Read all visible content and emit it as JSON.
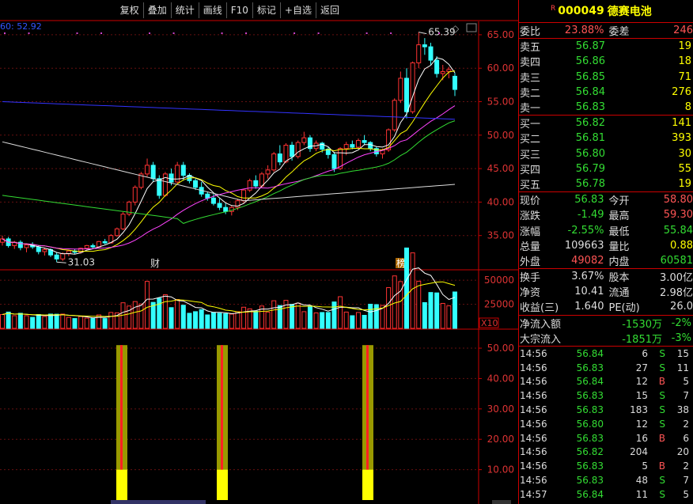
{
  "toolbar": [
    "复权",
    "叠加",
    "统计",
    "画线",
    "F10",
    "标记",
    "+自选",
    "返回"
  ],
  "stock": {
    "code": "000049",
    "name": "德赛电池",
    "code_color": "#ffff00",
    "name_color": "#ffff00"
  },
  "order_ratio": {
    "label1": "委比",
    "value1": "23.88%",
    "label2": "委差",
    "value2": "246"
  },
  "asks": [
    {
      "label": "卖五",
      "price": "56.87",
      "vol": "19"
    },
    {
      "label": "卖四",
      "price": "56.86",
      "vol": "18"
    },
    {
      "label": "卖三",
      "price": "56.85",
      "vol": "71"
    },
    {
      "label": "卖二",
      "price": "56.84",
      "vol": "276"
    },
    {
      "label": "卖一",
      "price": "56.83",
      "vol": "8"
    }
  ],
  "bids": [
    {
      "label": "买一",
      "price": "56.82",
      "vol": "141"
    },
    {
      "label": "买二",
      "price": "56.81",
      "vol": "393"
    },
    {
      "label": "买三",
      "price": "56.80",
      "vol": "30"
    },
    {
      "label": "买四",
      "price": "56.79",
      "vol": "55"
    },
    {
      "label": "买五",
      "price": "56.78",
      "vol": "19"
    }
  ],
  "quote": [
    {
      "l1": "现价",
      "v1": "56.83",
      "c1": "green",
      "l2": "今开",
      "v2": "58.80",
      "c2": "red"
    },
    {
      "l1": "涨跌",
      "v1": "-1.49",
      "c1": "green",
      "l2": "最高",
      "v2": "59.30",
      "c2": "red"
    },
    {
      "l1": "涨幅",
      "v1": "-2.55%",
      "c1": "green",
      "l2": "最低",
      "v2": "55.84",
      "c2": "green"
    },
    {
      "l1": "总量",
      "v1": "109663",
      "c1": "white",
      "l2": "量比",
      "v2": "0.88",
      "c2": "yellow"
    },
    {
      "l1": "外盘",
      "v1": "49082",
      "c1": "red",
      "l2": "内盘",
      "v2": "60581",
      "c2": "green"
    }
  ],
  "fundamentals": [
    {
      "l1": "换手",
      "v1": "3.67%",
      "l2": "股本",
      "v2": "3.00亿"
    },
    {
      "l1": "净资",
      "v1": "10.41",
      "l2": "流通",
      "v2": "2.98亿"
    },
    {
      "l1": "收益(三)",
      "v1": "1.640",
      "l2": "PE(动)",
      "v2": "26.0"
    }
  ],
  "flows": [
    {
      "label": "净流入额",
      "value": "-1530万",
      "pct": "-2%"
    },
    {
      "label": "大宗流入",
      "value": "-1851万",
      "pct": "-3%"
    }
  ],
  "ticks": [
    {
      "time": "14:56",
      "price": "56.84",
      "vol": "6",
      "bs": "S",
      "n": "15"
    },
    {
      "time": "14:56",
      "price": "56.83",
      "vol": "27",
      "bs": "S",
      "n": "11"
    },
    {
      "time": "14:56",
      "price": "56.84",
      "vol": "12",
      "bs": "B",
      "n": "5"
    },
    {
      "time": "14:56",
      "price": "56.83",
      "vol": "15",
      "bs": "S",
      "n": "7"
    },
    {
      "time": "14:56",
      "price": "56.83",
      "vol": "183",
      "bs": "S",
      "n": "38"
    },
    {
      "time": "14:56",
      "price": "56.80",
      "vol": "12",
      "bs": "S",
      "n": "2"
    },
    {
      "time": "14:56",
      "price": "56.83",
      "vol": "16",
      "bs": "B",
      "n": "6"
    },
    {
      "time": "14:56",
      "price": "56.82",
      "vol": "204",
      "bs": "",
      "n": "20"
    },
    {
      "time": "14:56",
      "price": "56.83",
      "vol": "5",
      "bs": "B",
      "n": "2"
    },
    {
      "time": "14:56",
      "price": "56.83",
      "vol": "48",
      "bs": "S",
      "n": "7"
    },
    {
      "time": "14:57",
      "price": "56.84",
      "vol": "11",
      "bs": "S",
      "n": "5"
    }
  ],
  "chart_data": [
    {
      "type": "candlestick",
      "ma_legend": "60: 52.92",
      "y_ticks": [
        "65.00",
        "60.00",
        "55.00",
        "50.00",
        "45.00",
        "40.00",
        "35.00"
      ],
      "ylim": [
        30,
        67
      ],
      "high_annotation": "65.39",
      "low_annotation": "31.03",
      "markers": [
        "财",
        "榜"
      ],
      "up_color": "#ff3333",
      "down_color": "#33ffff",
      "candles": [
        [
          34,
          35,
          33.5,
          34.5
        ],
        [
          34.5,
          34.8,
          33.2,
          33.5
        ],
        [
          33.5,
          34.2,
          33,
          34
        ],
        [
          34,
          34.3,
          32.8,
          33.2
        ],
        [
          33.2,
          33.8,
          32.5,
          33.6
        ],
        [
          33.6,
          34,
          33,
          33.3
        ],
        [
          33.3,
          33.5,
          32.2,
          32.6
        ],
        [
          32.6,
          33.2,
          32,
          32.9
        ],
        [
          32.9,
          33.1,
          31.8,
          32.1
        ],
        [
          32.1,
          32.5,
          31.03,
          31.5
        ],
        [
          31.5,
          32.5,
          31.2,
          32.3
        ],
        [
          32.3,
          32.8,
          31.9,
          32.7
        ],
        [
          32.7,
          33,
          32.2,
          32.5
        ],
        [
          32.5,
          33.2,
          32.3,
          33.1
        ],
        [
          33.1,
          33.6,
          32.9,
          33.5
        ],
        [
          33.5,
          33.8,
          33,
          33.3
        ],
        [
          33.3,
          34.2,
          33.1,
          34.1
        ],
        [
          34.1,
          34.5,
          33.7,
          33.9
        ],
        [
          33.9,
          35.2,
          33.8,
          35
        ],
        [
          35,
          36.2,
          34.8,
          36
        ],
        [
          36,
          38.5,
          35.8,
          38.2
        ],
        [
          38.2,
          40.2,
          37.9,
          40
        ],
        [
          40,
          42.5,
          39.5,
          42.2
        ],
        [
          42.2,
          44.5,
          41.9,
          44.2
        ],
        [
          44.2,
          46.5,
          43.8,
          45.5
        ],
        [
          45.5,
          46,
          43,
          43.5
        ],
        [
          43.5,
          44,
          40.5,
          41
        ],
        [
          41,
          44.5,
          40.8,
          44.2
        ],
        [
          44.2,
          45,
          42.5,
          43
        ],
        [
          43,
          46,
          42.8,
          45.5
        ],
        [
          45.5,
          46,
          43.2,
          44
        ],
        [
          44,
          44.3,
          42.8,
          43.2
        ],
        [
          43.2,
          43.5,
          41.8,
          42.2
        ],
        [
          42.2,
          43,
          40.8,
          41.2
        ],
        [
          41.2,
          41.5,
          40.2,
          40.6
        ],
        [
          40.6,
          41.2,
          39.5,
          39.8
        ],
        [
          39.8,
          40.5,
          38.8,
          39.2
        ],
        [
          39.2,
          39.8,
          38.2,
          38.6
        ],
        [
          38.6,
          39.5,
          38,
          39.2
        ],
        [
          39.2,
          40.5,
          38.8,
          40.2
        ],
        [
          40.2,
          42,
          39.8,
          41.8
        ],
        [
          41.8,
          43.5,
          41.5,
          43.2
        ],
        [
          43.2,
          44,
          42,
          42.4
        ],
        [
          42.4,
          44.5,
          42.2,
          44.2
        ],
        [
          44.2,
          45.5,
          43.5,
          44.8
        ],
        [
          44.8,
          47.5,
          44.5,
          47.2
        ],
        [
          47.2,
          48.5,
          45.5,
          46
        ],
        [
          46,
          48.8,
          45.8,
          48.5
        ],
        [
          48.5,
          49,
          46.2,
          46.8
        ],
        [
          46.8,
          49.2,
          46.5,
          48.9
        ],
        [
          48.9,
          50.5,
          48.5,
          49.6
        ],
        [
          49.6,
          50,
          47.5,
          48
        ],
        [
          48,
          49.2,
          47.6,
          48.8
        ],
        [
          48.8,
          49,
          47.4,
          47.9
        ],
        [
          47.9,
          48.2,
          46.5,
          47.1
        ],
        [
          47.1,
          47.5,
          44.5,
          45
        ],
        [
          45,
          48.2,
          44.8,
          48
        ],
        [
          48,
          49,
          47,
          48.6
        ],
        [
          48.6,
          49.2,
          47.9,
          48.2
        ],
        [
          48.2,
          49.5,
          48,
          49.2
        ],
        [
          49.2,
          50,
          48.5,
          48.9
        ],
        [
          48.9,
          49.1,
          47.6,
          48
        ],
        [
          48,
          48.3,
          46.8,
          47.2
        ],
        [
          47.2,
          48,
          46.5,
          47.8
        ],
        [
          47.8,
          51,
          47.5,
          50.8
        ],
        [
          50.8,
          55.5,
          50.5,
          55.2
        ],
        [
          55.2,
          59.5,
          54.8,
          58.5
        ],
        [
          58.5,
          60,
          52.5,
          53.5
        ],
        [
          53.5,
          61,
          53.2,
          60.8
        ],
        [
          60.8,
          65.39,
          60,
          63.5
        ],
        [
          63.5,
          64.5,
          62,
          63.2
        ],
        [
          63.2,
          63.8,
          60.5,
          61.2
        ],
        [
          61.2,
          61.8,
          58.6,
          59.2
        ],
        [
          59.2,
          60.5,
          58.2,
          59.5
        ],
        [
          59.5,
          60.2,
          58.5,
          59.8
        ],
        [
          58.8,
          59.3,
          55.84,
          56.83
        ]
      ],
      "ma_lines": [
        {
          "name": "MA5",
          "color": "#ffffff"
        },
        {
          "name": "MA10",
          "color": "#ffff00"
        },
        {
          "name": "MA20",
          "color": "#ff44ff"
        },
        {
          "name": "MA30",
          "color": "#33dd33"
        },
        {
          "name": "MA60",
          "color": "#3333ff"
        },
        {
          "name": "MA120",
          "color": "#dddddd"
        }
      ],
      "volume": {
        "y_ticks": [
          "50000",
          "25000"
        ],
        "unit": "X10"
      },
      "indicator": {
        "y_ticks": [
          "50.00",
          "40.00",
          "30.00",
          "20.00",
          "10.00"
        ],
        "bars": [
          {
            "index": 20,
            "value": 51,
            "base": 10
          },
          {
            "index": 39,
            "value": 51,
            "base": 10
          },
          {
            "index": 67,
            "value": 51,
            "base": 10
          }
        ]
      }
    }
  ]
}
